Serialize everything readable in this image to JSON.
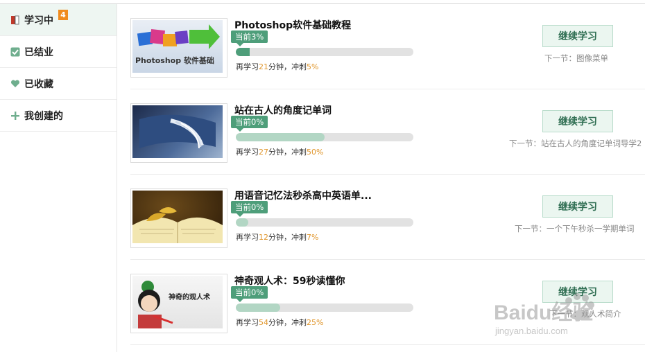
{
  "sidebar": {
    "items": [
      {
        "label": "学习中",
        "icon": "book-icon",
        "badge": "4",
        "active": true
      },
      {
        "label": "已结业",
        "icon": "checkbox-icon"
      },
      {
        "label": "已收藏",
        "icon": "heart-icon"
      },
      {
        "label": "我创建的",
        "icon": "plus-icon"
      }
    ]
  },
  "courses": [
    {
      "title": "Photoshop软件基础教程",
      "current_label": "当前3%",
      "current_pct": 3,
      "sprint_pct": 5,
      "meta": {
        "prefix": "再学习",
        "minutes": "21",
        "mid": "分钟，冲刺",
        "sprint": "5%"
      },
      "button": "继续学习",
      "next": "下一节：图像菜单",
      "thumb_text": "Photoshop 软件基础"
    },
    {
      "title": "站在古人的角度记单词",
      "current_label": "当前0%",
      "current_pct": 0,
      "sprint_pct": 50,
      "meta": {
        "prefix": "再学习",
        "minutes": "27",
        "mid": "分钟，冲刺",
        "sprint": "50%"
      },
      "button": "继续学习",
      "next": "下一节：站在古人的角度记单词导学2"
    },
    {
      "title": "用语音记忆法秒杀高中英语单...",
      "current_label": "当前0%",
      "current_pct": 0,
      "sprint_pct": 7,
      "meta": {
        "prefix": "再学习",
        "minutes": "12",
        "mid": "分钟，冲刺",
        "sprint": "7%"
      },
      "button": "继续学习",
      "next": "下一节：一个下午秒杀一学期单词"
    },
    {
      "title": "神奇观人术：59秒读懂你",
      "current_label": "当前0%",
      "current_pct": 0,
      "sprint_pct": 25,
      "meta": {
        "prefix": "再学习",
        "minutes": "54",
        "mid": "分钟，冲刺",
        "sprint": "25%"
      },
      "button": "继续学习",
      "next": "下一节：观人术简介",
      "thumb_text": "神奇的观人术"
    }
  ],
  "watermark": {
    "brand": "Baidu经验",
    "url": "jingyan.baidu.com"
  },
  "colors": {
    "accent": "#4e9e7a",
    "sprint": "#b2d6c4",
    "highlight": "#e0962c",
    "badge": "#f08c1e"
  }
}
